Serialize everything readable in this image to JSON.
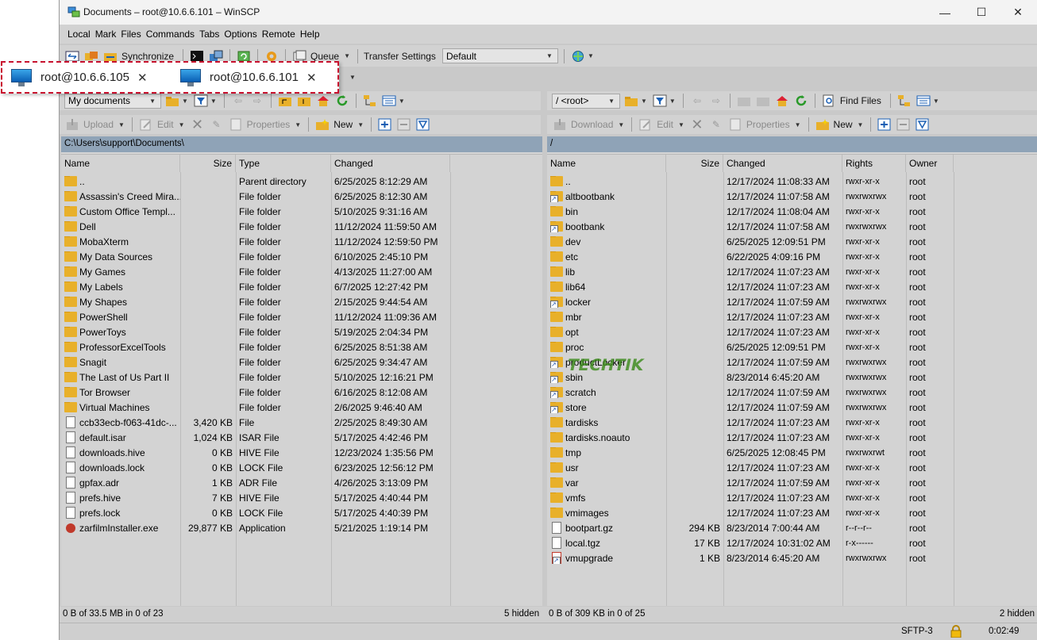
{
  "window": {
    "title": "Documents – root@10.6.6.101 – WinSCP"
  },
  "menu": [
    "Local",
    "Mark",
    "Files",
    "Commands",
    "Tabs",
    "Options",
    "Remote",
    "Help"
  ],
  "toolbar1": {
    "synchronize": "Synchronize",
    "queue": "Queue",
    "transfer_settings_label": "Transfer Settings",
    "transfer_settings_value": "Default"
  },
  "tabs": [
    {
      "label": "root@10.6.6.105"
    },
    {
      "label": "root@10.6.6.101"
    }
  ],
  "left_nav": {
    "location": "My documents"
  },
  "left_actions": {
    "upload": "Upload",
    "edit": "Edit",
    "properties": "Properties",
    "new": "New"
  },
  "right_nav": {
    "location": "/ <root>",
    "find_files": "Find Files"
  },
  "right_actions": {
    "download": "Download",
    "edit": "Edit",
    "properties": "Properties",
    "new": "New"
  },
  "left": {
    "path": "C:\\Users\\support\\Documents\\",
    "columns": {
      "name": "Name",
      "size": "Size",
      "type": "Type",
      "changed": "Changed"
    },
    "rows": [
      {
        "name": "..",
        "size": "",
        "type": "Parent directory",
        "changed": "6/25/2025 8:12:29 AM",
        "icon": "parent"
      },
      {
        "name": "Assassin's Creed Mira...",
        "size": "",
        "type": "File folder",
        "changed": "6/25/2025 8:12:30 AM",
        "icon": "folder"
      },
      {
        "name": "Custom Office Templ...",
        "size": "",
        "type": "File folder",
        "changed": "5/10/2025 9:31:16 AM",
        "icon": "folder"
      },
      {
        "name": "Dell",
        "size": "",
        "type": "File folder",
        "changed": "11/12/2024 11:59:50 AM",
        "icon": "folder"
      },
      {
        "name": "MobaXterm",
        "size": "",
        "type": "File folder",
        "changed": "11/12/2024 12:59:50 PM",
        "icon": "folder"
      },
      {
        "name": "My Data Sources",
        "size": "",
        "type": "File folder",
        "changed": "6/10/2025 2:45:10 PM",
        "icon": "folder"
      },
      {
        "name": "My Games",
        "size": "",
        "type": "File folder",
        "changed": "4/13/2025 11:27:00 AM",
        "icon": "folder"
      },
      {
        "name": "My Labels",
        "size": "",
        "type": "File folder",
        "changed": "6/7/2025 12:27:42 PM",
        "icon": "folder"
      },
      {
        "name": "My Shapes",
        "size": "",
        "type": "File folder",
        "changed": "2/15/2025 9:44:54 AM",
        "icon": "folder"
      },
      {
        "name": "PowerShell",
        "size": "",
        "type": "File folder",
        "changed": "11/12/2024 11:09:36 AM",
        "icon": "folder"
      },
      {
        "name": "PowerToys",
        "size": "",
        "type": "File folder",
        "changed": "5/19/2025 2:04:34 PM",
        "icon": "folder"
      },
      {
        "name": "ProfessorExcelTools",
        "size": "",
        "type": "File folder",
        "changed": "6/25/2025 8:51:38 AM",
        "icon": "folder"
      },
      {
        "name": "Snagit",
        "size": "",
        "type": "File folder",
        "changed": "6/25/2025 9:34:47 AM",
        "icon": "folder"
      },
      {
        "name": "The Last of Us Part II",
        "size": "",
        "type": "File folder",
        "changed": "5/10/2025 12:16:21 PM",
        "icon": "folder"
      },
      {
        "name": "Tor Browser",
        "size": "",
        "type": "File folder",
        "changed": "6/16/2025 8:12:08 AM",
        "icon": "folder"
      },
      {
        "name": "Virtual Machines",
        "size": "",
        "type": "File folder",
        "changed": "2/6/2025 9:46:40 AM",
        "icon": "folder"
      },
      {
        "name": "ccb33ecb-f063-41dc-...",
        "size": "3,420 KB",
        "type": "File",
        "changed": "2/25/2025 8:49:30 AM",
        "icon": "doc"
      },
      {
        "name": "default.isar",
        "size": "1,024 KB",
        "type": "ISAR File",
        "changed": "5/17/2025 4:42:46 PM",
        "icon": "doc"
      },
      {
        "name": "downloads.hive",
        "size": "0 KB",
        "type": "HIVE File",
        "changed": "12/23/2024 1:35:56 PM",
        "icon": "doc"
      },
      {
        "name": "downloads.lock",
        "size": "0 KB",
        "type": "LOCK File",
        "changed": "6/23/2025 12:56:12 PM",
        "icon": "doc"
      },
      {
        "name": "gpfax.adr",
        "size": "1 KB",
        "type": "ADR File",
        "changed": "4/26/2025 3:13:09 PM",
        "icon": "doc"
      },
      {
        "name": "prefs.hive",
        "size": "7 KB",
        "type": "HIVE File",
        "changed": "5/17/2025 4:40:44 PM",
        "icon": "doc"
      },
      {
        "name": "prefs.lock",
        "size": "0 KB",
        "type": "LOCK File",
        "changed": "5/17/2025 4:40:39 PM",
        "icon": "doc"
      },
      {
        "name": "zarfilmInstaller.exe",
        "size": "29,877 KB",
        "type": "Application",
        "changed": "5/21/2025 1:19:14 PM",
        "icon": "exe"
      }
    ],
    "status": "0 B of 33.5 MB in 0 of 23",
    "hidden": "5 hidden"
  },
  "right": {
    "path": "/",
    "columns": {
      "name": "Name",
      "size": "Size",
      "changed": "Changed",
      "rights": "Rights",
      "owner": "Owner"
    },
    "rows": [
      {
        "name": "..",
        "size": "",
        "changed": "12/17/2024 11:08:33 AM",
        "rights": "rwxr-xr-x",
        "owner": "root",
        "icon": "parent"
      },
      {
        "name": "altbootbank",
        "size": "",
        "changed": "12/17/2024 11:07:58 AM",
        "rights": "rwxrwxrwx",
        "owner": "root",
        "icon": "link"
      },
      {
        "name": "bin",
        "size": "",
        "changed": "12/17/2024 11:08:04 AM",
        "rights": "rwxr-xr-x",
        "owner": "root",
        "icon": "folder"
      },
      {
        "name": "bootbank",
        "size": "",
        "changed": "12/17/2024 11:07:58 AM",
        "rights": "rwxrwxrwx",
        "owner": "root",
        "icon": "link"
      },
      {
        "name": "dev",
        "size": "",
        "changed": "6/25/2025 12:09:51 PM",
        "rights": "rwxr-xr-x",
        "owner": "root",
        "icon": "folder"
      },
      {
        "name": "etc",
        "size": "",
        "changed": "6/22/2025 4:09:16 PM",
        "rights": "rwxr-xr-x",
        "owner": "root",
        "icon": "folder"
      },
      {
        "name": "lib",
        "size": "",
        "changed": "12/17/2024 11:07:23 AM",
        "rights": "rwxr-xr-x",
        "owner": "root",
        "icon": "folder"
      },
      {
        "name": "lib64",
        "size": "",
        "changed": "12/17/2024 11:07:23 AM",
        "rights": "rwxr-xr-x",
        "owner": "root",
        "icon": "folder"
      },
      {
        "name": "locker",
        "size": "",
        "changed": "12/17/2024 11:07:59 AM",
        "rights": "rwxrwxrwx",
        "owner": "root",
        "icon": "link"
      },
      {
        "name": "mbr",
        "size": "",
        "changed": "12/17/2024 11:07:23 AM",
        "rights": "rwxr-xr-x",
        "owner": "root",
        "icon": "folder"
      },
      {
        "name": "opt",
        "size": "",
        "changed": "12/17/2024 11:07:23 AM",
        "rights": "rwxr-xr-x",
        "owner": "root",
        "icon": "folder"
      },
      {
        "name": "proc",
        "size": "",
        "changed": "6/25/2025 12:09:51 PM",
        "rights": "rwxr-xr-x",
        "owner": "root",
        "icon": "folder"
      },
      {
        "name": "productLocker",
        "size": "",
        "changed": "12/17/2024 11:07:59 AM",
        "rights": "rwxrwxrwx",
        "owner": "root",
        "icon": "link"
      },
      {
        "name": "sbin",
        "size": "",
        "changed": "8/23/2014 6:45:20 AM",
        "rights": "rwxrwxrwx",
        "owner": "root",
        "icon": "link"
      },
      {
        "name": "scratch",
        "size": "",
        "changed": "12/17/2024 11:07:59 AM",
        "rights": "rwxrwxrwx",
        "owner": "root",
        "icon": "link"
      },
      {
        "name": "store",
        "size": "",
        "changed": "12/17/2024 11:07:59 AM",
        "rights": "rwxrwxrwx",
        "owner": "root",
        "icon": "link"
      },
      {
        "name": "tardisks",
        "size": "",
        "changed": "12/17/2024 11:07:23 AM",
        "rights": "rwxr-xr-x",
        "owner": "root",
        "icon": "folder"
      },
      {
        "name": "tardisks.noauto",
        "size": "",
        "changed": "12/17/2024 11:07:23 AM",
        "rights": "rwxr-xr-x",
        "owner": "root",
        "icon": "folder"
      },
      {
        "name": "tmp",
        "size": "",
        "changed": "6/25/2025 12:08:45 PM",
        "rights": "rwxrwxrwt",
        "owner": "root",
        "icon": "folder"
      },
      {
        "name": "usr",
        "size": "",
        "changed": "12/17/2024 11:07:23 AM",
        "rights": "rwxr-xr-x",
        "owner": "root",
        "icon": "folder"
      },
      {
        "name": "var",
        "size": "",
        "changed": "12/17/2024 11:07:59 AM",
        "rights": "rwxr-xr-x",
        "owner": "root",
        "icon": "folder"
      },
      {
        "name": "vmfs",
        "size": "",
        "changed": "12/17/2024 11:07:23 AM",
        "rights": "rwxr-xr-x",
        "owner": "root",
        "icon": "folder"
      },
      {
        "name": "vmimages",
        "size": "",
        "changed": "12/17/2024 11:07:23 AM",
        "rights": "rwxr-xr-x",
        "owner": "root",
        "icon": "folder"
      },
      {
        "name": "bootpart.gz",
        "size": "294 KB",
        "changed": "8/23/2014 7:00:44 AM",
        "rights": "r--r--r--",
        "owner": "root",
        "icon": "doc"
      },
      {
        "name": "local.tgz",
        "size": "17 KB",
        "changed": "12/17/2024 10:31:02 AM",
        "rights": "r-x------",
        "owner": "root",
        "icon": "doc"
      },
      {
        "name": "vmupgrade",
        "size": "1 KB",
        "changed": "8/23/2014 6:45:20 AM",
        "rights": "rwxrwxrwx",
        "owner": "root",
        "icon": "doclink"
      }
    ],
    "status": "0 B of 309 KB in 0 of 25",
    "hidden": "2 hidden"
  },
  "bottom": {
    "protocol": "SFTP-3",
    "time": "0:02:49"
  },
  "watermark": "TECHTIK"
}
